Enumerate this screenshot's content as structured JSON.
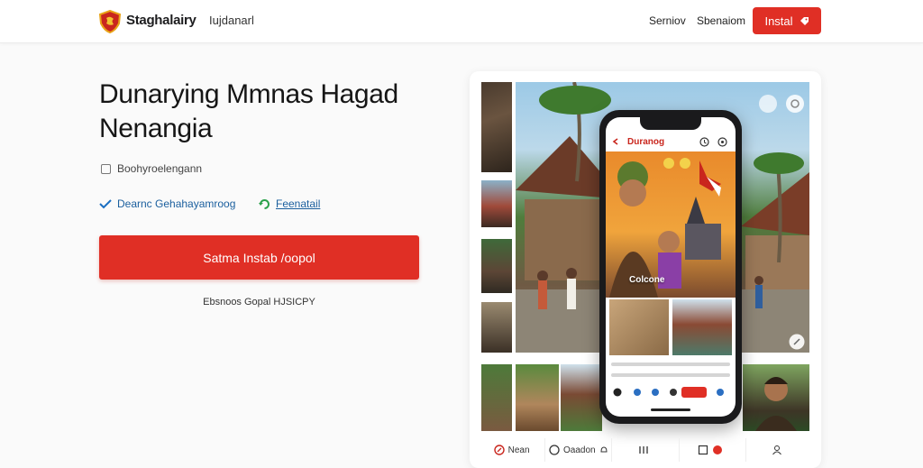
{
  "header": {
    "brand": "Staghalairy",
    "brand_sub": "Iujdanarl",
    "nav": [
      "Serniov",
      "Sbenaiom"
    ],
    "install_label": "Instal"
  },
  "hero": {
    "title": "Dunarying Mmnas Hagad Nenangia",
    "checkbox_label": "Boohyroelengann",
    "features": [
      "Dearnc Gehahayamroog",
      "Feenatail"
    ],
    "cta_label": "Satma Instab /oopol",
    "footnote": "Ebsnoos Gopal HJSICPY"
  },
  "phone_app": {
    "title": "Duranog",
    "caption": "Colcone"
  },
  "bottom_nav": [
    "Nean",
    "Oaadon",
    "",
    "",
    ""
  ],
  "colors": {
    "accent": "#e02f25",
    "link": "#1b5f9e"
  }
}
